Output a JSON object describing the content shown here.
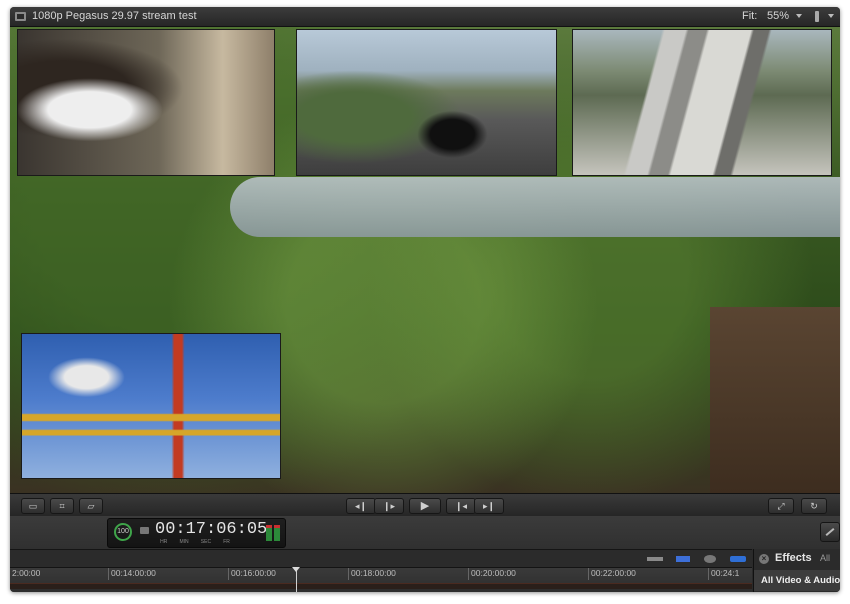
{
  "window": {
    "title": "1080p Pegasus 29.97 stream test",
    "fit_label": "Fit:",
    "zoom": "55%"
  },
  "viewer": {
    "clips": [
      "horse-clip",
      "street-clip",
      "track-clip",
      "coaster-clip"
    ]
  },
  "transport": {
    "buttons": [
      "crop-icon",
      "transform-icon",
      "distort-icon",
      "prev-frame-icon",
      "next-frame-icon",
      "play-icon",
      "go-to-start-icon",
      "go-to-end-icon",
      "fullscreen-icon",
      "loop-icon"
    ]
  },
  "dashboard": {
    "percent": "100",
    "timecode": "00:17:06:05",
    "units": [
      "HR",
      "MIN",
      "SEC",
      "FR"
    ]
  },
  "timeline": {
    "ticks": [
      "2:00:00",
      "00:14:00:00",
      "00:16:00:00",
      "00:18:00:00",
      "00:20:00:00",
      "00:22:00:00",
      "00:24:1"
    ]
  },
  "effects": {
    "title": "Effects",
    "all": "All",
    "category": "All Video & Audio"
  },
  "colors": {
    "accent_green": "#3fa54a",
    "meter_red": "#c93030",
    "blue_toggle": "#2f6fd6"
  }
}
